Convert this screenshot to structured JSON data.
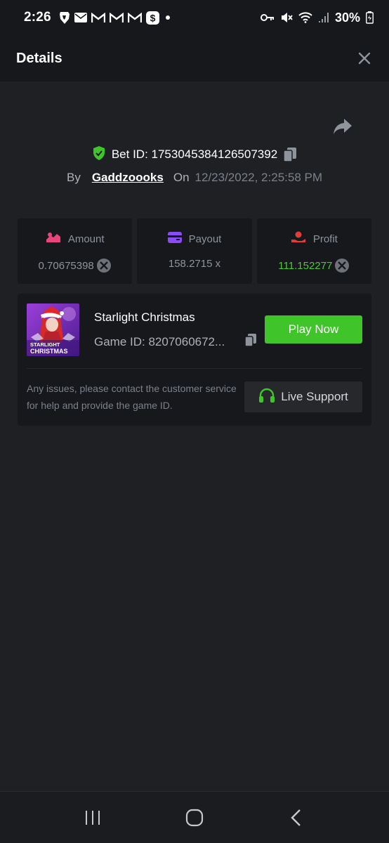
{
  "status_bar": {
    "time": "2:26",
    "battery_percent": "30%",
    "left_icons": [
      "brave-icon",
      "mail-icon",
      "gmail-icon",
      "gmail-icon",
      "gmail-icon",
      "cash-app-icon",
      "dot-icon"
    ],
    "right_icons": [
      "key-icon",
      "mute-icon",
      "wifi-icon",
      "signal-icon",
      "battery-icon"
    ]
  },
  "header": {
    "title": "Details",
    "close_icon": "close-icon"
  },
  "bet": {
    "bet_id_label": "Bet ID: 1753045384126507392",
    "by_label": "By",
    "username": "Gaddzoooks",
    "on_label": "On",
    "date": "12/23/2022, 2:25:58 PM"
  },
  "stats": [
    {
      "label": "Amount",
      "value": "0.70675398",
      "icon": "amount-icon",
      "has_coin": true,
      "color": "#8e939c"
    },
    {
      "label": "Payout",
      "value": "158.2715 x",
      "icon": "wallet-icon",
      "has_coin": false,
      "color": "#8e939c"
    },
    {
      "label": "Profit",
      "value": "111.152277",
      "icon": "profit-icon",
      "has_coin": true,
      "color": "#4ac935"
    }
  ],
  "game": {
    "name": "Starlight Christmas",
    "game_id": "Game ID: 8207060672...",
    "thumb_text_1": "STARLIGHT",
    "thumb_text_2": "CHRISTMAS",
    "play_label": "Play Now"
  },
  "support": {
    "help_text": "Any issues, please contact the customer service for help and provide the game ID.",
    "button_label": "Live Support"
  },
  "colors": {
    "accent_green": "#3fc42a",
    "shield_green": "#3fc42a",
    "amount_pink": "#e8457a",
    "payout_purple": "#8a4cf7",
    "profit_red": "#e5393a"
  }
}
